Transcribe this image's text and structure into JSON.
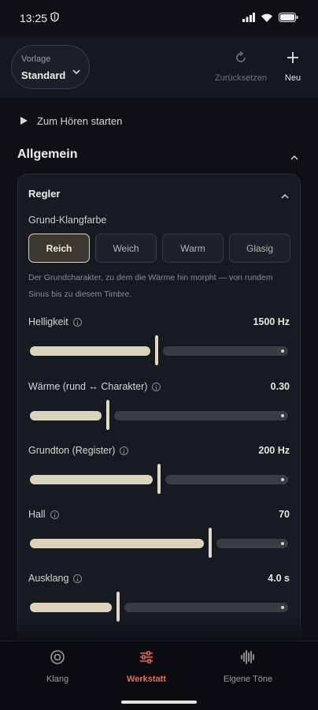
{
  "status": {
    "time": "13:25"
  },
  "header": {
    "preset_caption": "Vorlage",
    "preset_value": "Standard",
    "reset_label": "Zurücksetzen",
    "new_label": "Neu"
  },
  "listen": {
    "label": "Zum Hören starten"
  },
  "section": {
    "title": "Allgemein"
  },
  "card": {
    "title": "Regler",
    "timbre_label": "Grund-Klangfarbe",
    "timbre_options": [
      "Reich",
      "Weich",
      "Warm",
      "Glasig"
    ],
    "timbre_selected": "Reich",
    "timbre_description": "Der Grundcharakter, zu dem die Wärme hin morpht — von rundem Sinus bis zu diesem Timbre."
  },
  "sliders": [
    {
      "label": "Helligkeit",
      "value": "1500 Hz",
      "fraction": 0.49
    },
    {
      "label": "Wärme (rund ↔ Charakter)",
      "value": "0.30",
      "fraction": 0.3
    },
    {
      "label": "Grundton (Register)",
      "value": "200 Hz",
      "fraction": 0.5
    },
    {
      "label": "Hall",
      "value": "70",
      "fraction": 0.7
    },
    {
      "label": "Ausklang",
      "value": "4.0 s",
      "fraction": 0.34
    }
  ],
  "nav": {
    "items": [
      "Klang",
      "Werkstatt",
      "Eigene Töne"
    ],
    "active": "Werkstatt"
  },
  "colors": {
    "accent": "#e86a50",
    "slider_fill": "#dcd3bc",
    "background": "#0e1016"
  }
}
